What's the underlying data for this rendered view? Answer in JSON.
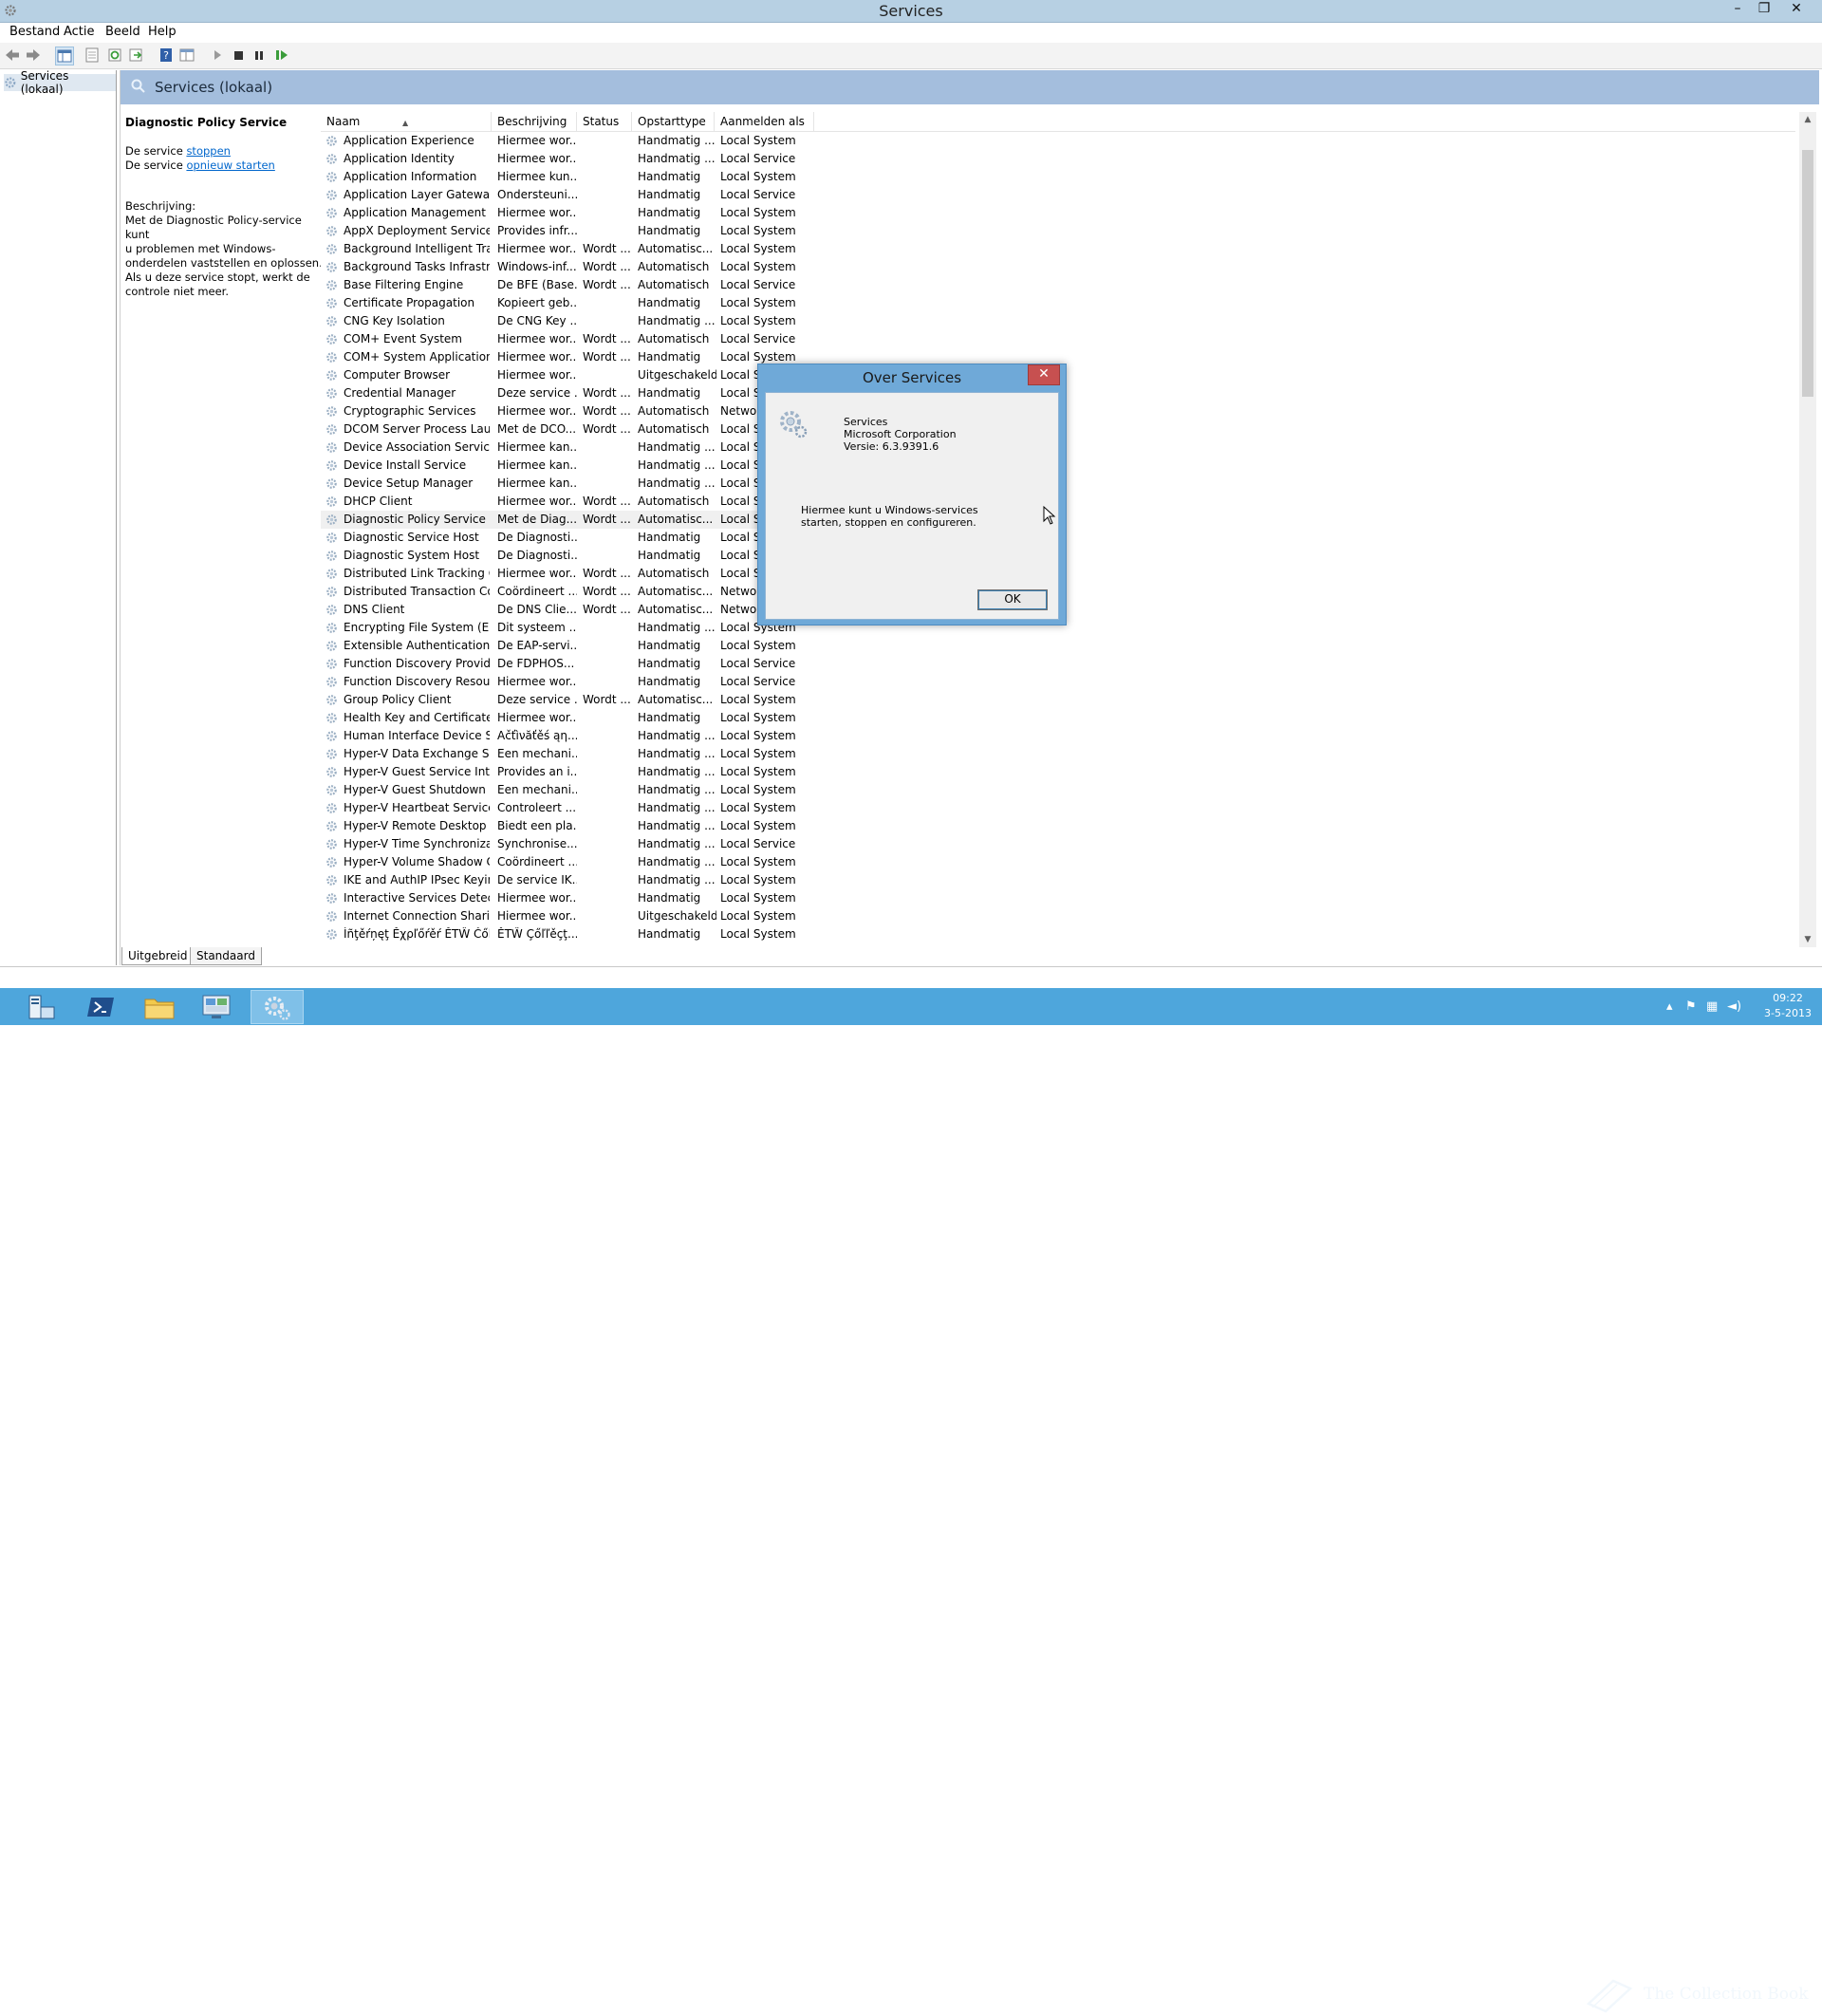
{
  "window": {
    "title": "Services",
    "buttons": {
      "minimize": "–",
      "restore": "❐",
      "close": "✕"
    }
  },
  "menu": [
    "Bestand",
    "Actie",
    "Beeld",
    "Help"
  ],
  "tree": {
    "node_label": "Services (lokaal)"
  },
  "main": {
    "header_title": "Services (lokaal)"
  },
  "details": {
    "service_name": "Diagnostic Policy Service",
    "stop_prefix": "De service ",
    "stop_link": "stoppen",
    "restart_prefix": "De service ",
    "restart_link": "opnieuw starten",
    "description_label": "Beschrijving:",
    "description_lines": [
      "Met de Diagnostic Policy-service kunt",
      "u problemen met Windows-",
      "onderdelen vaststellen en oplossen.",
      "Als u deze service stopt, werkt de",
      "controle niet meer."
    ]
  },
  "list": {
    "columns": [
      "Naam",
      "Beschrijving",
      "Status",
      "Opstarttype",
      "Aanmelden als"
    ],
    "selected_index": 21,
    "rows": [
      [
        "Application Experience",
        "Hiermee wor...",
        "",
        "Handmatig ...",
        "Local System"
      ],
      [
        "Application Identity",
        "Hiermee wor...",
        "",
        "Handmatig ...",
        "Local Service"
      ],
      [
        "Application Information",
        "Hiermee kun...",
        "",
        "Handmatig",
        "Local System"
      ],
      [
        "Application Layer Gateway ...",
        "Ondersteuni...",
        "",
        "Handmatig",
        "Local Service"
      ],
      [
        "Application Management",
        "Hiermee wor...",
        "",
        "Handmatig",
        "Local System"
      ],
      [
        "AppX Deployment Service (...",
        "Provides infr...",
        "",
        "Handmatig",
        "Local System"
      ],
      [
        "Background Intelligent Tran...",
        "Hiermee wor...",
        "Wordt ...",
        "Automatisc...",
        "Local System"
      ],
      [
        "Background Tasks Infrastru...",
        "Windows-inf...",
        "Wordt ...",
        "Automatisch",
        "Local System"
      ],
      [
        "Base Filtering Engine",
        "De BFE (Base...",
        "Wordt ...",
        "Automatisch",
        "Local Service"
      ],
      [
        "Certificate Propagation",
        "Kopieert geb...",
        "",
        "Handmatig",
        "Local System"
      ],
      [
        "CNG Key Isolation",
        "De CNG Key ...",
        "",
        "Handmatig ...",
        "Local System"
      ],
      [
        "COM+ Event System",
        "Hiermee wor...",
        "Wordt ...",
        "Automatisch",
        "Local Service"
      ],
      [
        "COM+ System Application",
        "Hiermee wor...",
        "Wordt ...",
        "Handmatig",
        "Local System"
      ],
      [
        "Computer Browser",
        "Hiermee wor...",
        "",
        "Uitgeschakeld",
        "Local Sy"
      ],
      [
        "Credential Manager",
        "Deze service ...",
        "Wordt ...",
        "Handmatig",
        "Local Sy"
      ],
      [
        "Cryptographic Services",
        "Hiermee wor...",
        "Wordt ...",
        "Automatisch",
        "Networ"
      ],
      [
        "DCOM Server Process Laun...",
        "Met de DCO...",
        "Wordt ...",
        "Automatisch",
        "Local Sy"
      ],
      [
        "Device Association Service",
        "Hiermee kan...",
        "",
        "Handmatig ...",
        "Local Sy"
      ],
      [
        "Device Install Service",
        "Hiermee kan...",
        "",
        "Handmatig ...",
        "Local Sy"
      ],
      [
        "Device Setup Manager",
        "Hiermee kan...",
        "",
        "Handmatig ...",
        "Local Sy"
      ],
      [
        "DHCP Client",
        "Hiermee wor...",
        "Wordt ...",
        "Automatisch",
        "Local Se"
      ],
      [
        "Diagnostic Policy Service",
        "Met de Diag...",
        "Wordt ...",
        "Automatisc...",
        "Local Se"
      ],
      [
        "Diagnostic Service Host",
        "De Diagnosti...",
        "",
        "Handmatig",
        "Local Se"
      ],
      [
        "Diagnostic System Host",
        "De Diagnosti...",
        "",
        "Handmatig",
        "Local Sy"
      ],
      [
        "Distributed Link Tracking Cl...",
        "Hiermee wor...",
        "Wordt ...",
        "Automatisch",
        "Local Sy"
      ],
      [
        "Distributed Transaction Co...",
        "Coördineert ...",
        "Wordt ...",
        "Automatisc...",
        "Networ"
      ],
      [
        "DNS Client",
        "De DNS Clie...",
        "Wordt ...",
        "Automatisc...",
        "Networ"
      ],
      [
        "Encrypting File System (EFS)",
        "Dit systeem ...",
        "",
        "Handmatig ...",
        "Local System"
      ],
      [
        "Extensible Authentication P...",
        "De EAP-servi...",
        "",
        "Handmatig",
        "Local System"
      ],
      [
        "Function Discovery Provide...",
        "De FDPHOS...",
        "",
        "Handmatig",
        "Local Service"
      ],
      [
        "Function Discovery Resourc...",
        "Hiermee wor...",
        "",
        "Handmatig",
        "Local Service"
      ],
      [
        "Group Policy Client",
        "Deze service ...",
        "Wordt ...",
        "Automatisc...",
        "Local System"
      ],
      [
        "Health Key and Certificate ...",
        "Hiermee wor...",
        "",
        "Handmatig",
        "Local System"
      ],
      [
        "Human Interface Device Ser...",
        "Аčťìνăťěś ąη...",
        "",
        "Handmatig ...",
        "Local System"
      ],
      [
        "Hyper-V Data Exchange Ser...",
        "Een mechani...",
        "",
        "Handmatig ...",
        "Local System"
      ],
      [
        "Hyper-V Guest Service Inter...",
        "Provides an i...",
        "",
        "Handmatig ...",
        "Local System"
      ],
      [
        "Hyper-V Guest Shutdown S...",
        "Een mechani...",
        "",
        "Handmatig ...",
        "Local System"
      ],
      [
        "Hyper-V Heartbeat Service",
        "Controleert ...",
        "",
        "Handmatig ...",
        "Local System"
      ],
      [
        "Hyper-V Remote Desktop Vi...",
        "Biedt een pla...",
        "",
        "Handmatig ...",
        "Local System"
      ],
      [
        "Hyper-V Time Synchronizat...",
        "Synchronise...",
        "",
        "Handmatig ...",
        "Local Service"
      ],
      [
        "Hyper-V Volume Shadow C...",
        "Coördineert ...",
        "",
        "Handmatig ...",
        "Local System"
      ],
      [
        "IKE and AuthIP IPsec Keying...",
        "De service IK...",
        "",
        "Handmatig ...",
        "Local System"
      ],
      [
        "Interactive Services Detection",
        "Hiermee wor...",
        "",
        "Handmatig",
        "Local System"
      ],
      [
        "Internet Connection Sharin...",
        "Hiermee wor...",
        "",
        "Uitgeschakeld",
        "Local System"
      ],
      [
        "Ìñţěŕņęţ Ěχρľőŕěŕ ĚΤŴ Čőľľ...",
        "ĚΤŴ Çőľľěçţ...",
        "",
        "Handmatig",
        "Local System"
      ]
    ]
  },
  "tabs": [
    "Uitgebreid",
    "Standaard"
  ],
  "dialog": {
    "title": "Over Services",
    "close": "✕",
    "product": "Services",
    "company": "Microsoft Corporation",
    "version": "Versie: 6.3.9391.6",
    "description": "Hiermee kunt u Windows-services starten, stoppen en configureren.",
    "ok": "OK"
  },
  "taskbar": {
    "time": "09:22",
    "date": "3-5-2013",
    "watermark": "The Collection Book"
  },
  "colors": {
    "titlebar": "#b7d0e3",
    "header": "#a4bedd",
    "taskbar": "#4ea6dc",
    "dialog_frame": "#6fa9d8",
    "link": "#0066cc"
  }
}
